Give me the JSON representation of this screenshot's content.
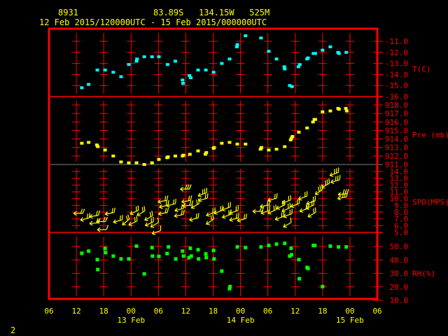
{
  "header": {
    "station_id": "8931",
    "location": "83.89S   134.15W   525M",
    "time_range": "12 Feb 2015/120000UTC - 15 Feb 2015/000000UTC"
  },
  "page_number": "2",
  "colors": {
    "frame": "#ff0000",
    "text": "#ffff00",
    "temperature": "#00ffff",
    "pressure": "#ffff00",
    "wind": "#ffff00",
    "rh": "#00ff00",
    "separator": "#808080"
  },
  "chart_data": {
    "type": "scatter",
    "title": "8931  83.89S 134.15W 525M",
    "x_units": "hours since 12 Feb 2015 06 UTC",
    "xlim": [
      0,
      72
    ],
    "x_ticks": [
      {
        "h": 0,
        "label": "06"
      },
      {
        "h": 6,
        "label": "12"
      },
      {
        "h": 12,
        "label": "18"
      },
      {
        "h": 18,
        "label": "00"
      },
      {
        "h": 24,
        "label": "06"
      },
      {
        "h": 30,
        "label": "12"
      },
      {
        "h": 36,
        "label": "18"
      },
      {
        "h": 42,
        "label": "00"
      },
      {
        "h": 48,
        "label": "06"
      },
      {
        "h": 54,
        "label": "12"
      },
      {
        "h": 60,
        "label": "18"
      },
      {
        "h": 66,
        "label": "00"
      },
      {
        "h": 72,
        "label": "06"
      }
    ],
    "date_labels": [
      {
        "h": 18,
        "label": "13 Feb"
      },
      {
        "h": 42,
        "label": "14 Feb"
      },
      {
        "h": 66,
        "label": "15 Feb"
      }
    ],
    "panels": [
      {
        "name": "temperature",
        "ylabel": "T(C)",
        "ylim": [
          -16,
          -11
        ],
        "ticks": [
          "-11.0",
          "-12.0",
          "-13.0",
          "-14.0",
          "-15.0",
          "-16.0"
        ],
        "points": [
          [
            7.2,
            -15.2
          ],
          [
            8.7,
            -14.9
          ],
          [
            10.6,
            -13.6
          ],
          [
            12.3,
            -13.6
          ],
          [
            14.1,
            -13.8
          ],
          [
            15.8,
            -14.2
          ],
          [
            17.5,
            -13.1
          ],
          [
            19.2,
            -12.8
          ],
          [
            19.3,
            -12.6
          ],
          [
            20.9,
            -12.4
          ],
          [
            22.6,
            -12.4
          ],
          [
            24.1,
            -12.4
          ],
          [
            26,
            -13.1
          ],
          [
            27.7,
            -12.8
          ],
          [
            29.3,
            -14.5
          ],
          [
            29.4,
            -14.8
          ],
          [
            30.8,
            -14.1
          ],
          [
            31.1,
            -14.3
          ],
          [
            32.7,
            -13.6
          ],
          [
            34.4,
            -13.6
          ],
          [
            36.1,
            -13.8
          ],
          [
            37.9,
            -13.0
          ],
          [
            39.6,
            -12.6
          ],
          [
            41.2,
            -11.5
          ],
          [
            41.3,
            -11.3
          ],
          [
            43.1,
            -10.5
          ],
          [
            46.5,
            -10.7
          ],
          [
            48.2,
            -11.9
          ],
          [
            49.9,
            -12.6
          ],
          [
            51.6,
            -13.3
          ],
          [
            51.7,
            -13.5
          ],
          [
            52.8,
            -15.0
          ],
          [
            53.3,
            -15.1
          ],
          [
            54.7,
            -13.3
          ],
          [
            55,
            -13.1
          ],
          [
            56.6,
            -12.6
          ],
          [
            56.8,
            -12.5
          ],
          [
            58,
            -12.1
          ],
          [
            58.4,
            -12.1
          ],
          [
            60,
            -11.8
          ],
          [
            61.7,
            -11.5
          ],
          [
            63.4,
            -12.0
          ],
          [
            63.6,
            -12.1
          ],
          [
            65.2,
            -12.0
          ]
        ]
      },
      {
        "name": "pressure",
        "ylabel": "Pre (mb)",
        "ylim": [
          911,
          918
        ],
        "ticks": [
          "918.0",
          "917.0",
          "916.0",
          "915.0",
          "914.0",
          "913.0",
          "912.0",
          "911.0"
        ],
        "points": [
          [
            7.2,
            913.5
          ],
          [
            8.7,
            913.6
          ],
          [
            10.5,
            913.3
          ],
          [
            10.7,
            913.1
          ],
          [
            12.3,
            912.7
          ],
          [
            14.1,
            912.0
          ],
          [
            15.8,
            911.3
          ],
          [
            17.5,
            911.2
          ],
          [
            19.2,
            911.2
          ],
          [
            20.9,
            911.0
          ],
          [
            22.6,
            911.2
          ],
          [
            24.1,
            911.6
          ],
          [
            25.9,
            911.8
          ],
          [
            26.1,
            911.9
          ],
          [
            27.7,
            912.0
          ],
          [
            29.3,
            912.0
          ],
          [
            29.5,
            912.1
          ],
          [
            30.9,
            912.2
          ],
          [
            32.7,
            912.6
          ],
          [
            34.3,
            912.2
          ],
          [
            34.5,
            912.4
          ],
          [
            36.1,
            912.9
          ],
          [
            36.2,
            913.0
          ],
          [
            37.9,
            913.5
          ],
          [
            39.6,
            913.6
          ],
          [
            41.3,
            913.4
          ],
          [
            43.1,
            913.4
          ],
          [
            46.4,
            912.8
          ],
          [
            46.6,
            913.0
          ],
          [
            48.2,
            912.7
          ],
          [
            49.9,
            912.8
          ],
          [
            51.7,
            913.1
          ],
          [
            53,
            913.9
          ],
          [
            53.2,
            914.1
          ],
          [
            53.4,
            914.3
          ],
          [
            54.8,
            914.8
          ],
          [
            56.6,
            915.3
          ],
          [
            57.9,
            916.0
          ],
          [
            58.2,
            916.3
          ],
          [
            58.4,
            916.3
          ],
          [
            60,
            917.2
          ],
          [
            61.7,
            917.3
          ],
          [
            63.4,
            917.6
          ],
          [
            63.6,
            917.5
          ],
          [
            65.1,
            917.6
          ],
          [
            65.3,
            917.3
          ]
        ]
      },
      {
        "name": "wind",
        "ylabel": "SPD(MPS)",
        "ylim": [
          5,
          14
        ],
        "ticks": [
          "14.0",
          "13.0",
          "12.0",
          "11.0",
          "10.0",
          "9.0",
          "8.0",
          "7.0",
          "6.0",
          "5.0"
        ],
        "points_h_speed_dirdeg": [
          [
            5.4,
            7.8,
            90
          ],
          [
            6.9,
            6.8,
            75
          ],
          [
            8.9,
            7.3,
            80
          ],
          [
            8.9,
            6.3,
            85
          ],
          [
            10.4,
            6.6,
            90
          ],
          [
            10.6,
            5.4,
            90
          ],
          [
            12.3,
            7.7,
            80
          ],
          [
            14.1,
            6.5,
            75
          ],
          [
            16.1,
            6.1,
            50
          ],
          [
            17.5,
            6.1,
            65
          ],
          [
            17.8,
            7.7,
            65
          ],
          [
            19.3,
            7.5,
            60
          ],
          [
            21,
            6.8,
            60
          ],
          [
            21.1,
            6.0,
            65
          ],
          [
            22.3,
            5.8,
            60
          ],
          [
            22.6,
            4.8,
            70
          ],
          [
            23.9,
            9.5,
            80
          ],
          [
            24.2,
            8.7,
            75
          ],
          [
            24,
            7.7,
            80
          ],
          [
            25.8,
            8.9,
            75
          ],
          [
            27.5,
            7.4,
            80
          ],
          [
            27.6,
            8.2,
            75
          ],
          [
            28.8,
            11.4,
            90
          ],
          [
            29.1,
            9.5,
            80
          ],
          [
            29.3,
            8.9,
            85
          ],
          [
            30.8,
            6.8,
            75
          ],
          [
            31.2,
            8.6,
            60
          ],
          [
            32.7,
            10.4,
            70
          ],
          [
            32.8,
            9.7,
            75
          ],
          [
            34.5,
            7.5,
            70
          ],
          [
            34.5,
            6.2,
            55
          ],
          [
            36.2,
            7.8,
            70
          ],
          [
            37.9,
            8.3,
            70
          ],
          [
            38,
            7.2,
            70
          ],
          [
            39.6,
            7.8,
            70
          ],
          [
            39.6,
            6.8,
            75
          ],
          [
            41.3,
            6.7,
            75
          ],
          [
            44.7,
            8.1,
            90
          ],
          [
            46.5,
            7.8,
            70
          ],
          [
            46.3,
            8.8,
            80
          ],
          [
            48,
            9.7,
            75
          ],
          [
            48,
            7.8,
            65
          ],
          [
            49.9,
            8.5,
            65
          ],
          [
            49.6,
            6.9,
            70
          ],
          [
            51.1,
            9.3,
            70
          ],
          [
            51.1,
            8.1,
            65
          ],
          [
            51.4,
            5.8,
            60
          ],
          [
            51.4,
            7.3,
            70
          ],
          [
            53,
            8.8,
            70
          ],
          [
            54.7,
            9.9,
            70
          ],
          [
            55,
            8.1,
            70
          ],
          [
            56.5,
            9.2,
            70
          ],
          [
            56.3,
            8.5,
            65
          ],
          [
            56.8,
            7.3,
            60
          ],
          [
            58.4,
            10.6,
            55
          ],
          [
            59.8,
            11.6,
            60
          ],
          [
            61.6,
            13.4,
            70
          ],
          [
            61.8,
            12.4,
            75
          ],
          [
            63.3,
            10.0,
            80
          ],
          [
            63.4,
            10.6,
            85
          ]
        ]
      },
      {
        "name": "relative_humidity",
        "ylabel": "RH(%)",
        "ylim": [
          10,
          50
        ],
        "ticks": [
          "50.0",
          "40.0",
          "30.0",
          "20.0",
          "10.0"
        ],
        "points": [
          [
            7.2,
            44.9
          ],
          [
            8.7,
            46.5
          ],
          [
            10.6,
            40.2
          ],
          [
            10.7,
            32.8
          ],
          [
            12.3,
            48.4
          ],
          [
            12.4,
            45.4
          ],
          [
            14.1,
            42.8
          ],
          [
            15.8,
            40.7
          ],
          [
            17.5,
            40.7
          ],
          [
            19.2,
            50.2
          ],
          [
            20.9,
            29.6
          ],
          [
            22.6,
            49.1
          ],
          [
            22.7,
            42.8
          ],
          [
            24.1,
            42.6
          ],
          [
            25.9,
            44.7
          ],
          [
            26.2,
            49.6
          ],
          [
            27.8,
            40.7
          ],
          [
            29.3,
            46.5
          ],
          [
            29.5,
            42.8
          ],
          [
            30.7,
            41.7
          ],
          [
            31,
            48.6
          ],
          [
            31.2,
            42.8
          ],
          [
            32.7,
            47.5
          ],
          [
            32.8,
            40.7
          ],
          [
            34.4,
            44.4
          ],
          [
            34.5,
            41.7
          ],
          [
            36.1,
            47
          ],
          [
            36.2,
            40.7
          ],
          [
            37.9,
            31.7
          ],
          [
            39.6,
            18.6
          ],
          [
            39.7,
            20.2
          ],
          [
            41.3,
            49.6
          ],
          [
            43.1,
            49.1
          ],
          [
            46.5,
            49.6
          ],
          [
            48.2,
            50.7
          ],
          [
            49.9,
            51.7
          ],
          [
            51.7,
            52.3
          ],
          [
            53.1,
            48.6
          ],
          [
            52.8,
            42.8
          ],
          [
            53.2,
            43.8
          ],
          [
            54.8,
            40.2
          ],
          [
            54.9,
            26
          ],
          [
            56.6,
            34.4
          ],
          [
            56.8,
            33.6
          ],
          [
            58,
            50.7
          ],
          [
            58.3,
            50.7
          ],
          [
            60,
            20.2
          ],
          [
            61.7,
            50.2
          ],
          [
            63.5,
            49.6
          ],
          [
            65.2,
            49.6
          ]
        ]
      }
    ]
  }
}
